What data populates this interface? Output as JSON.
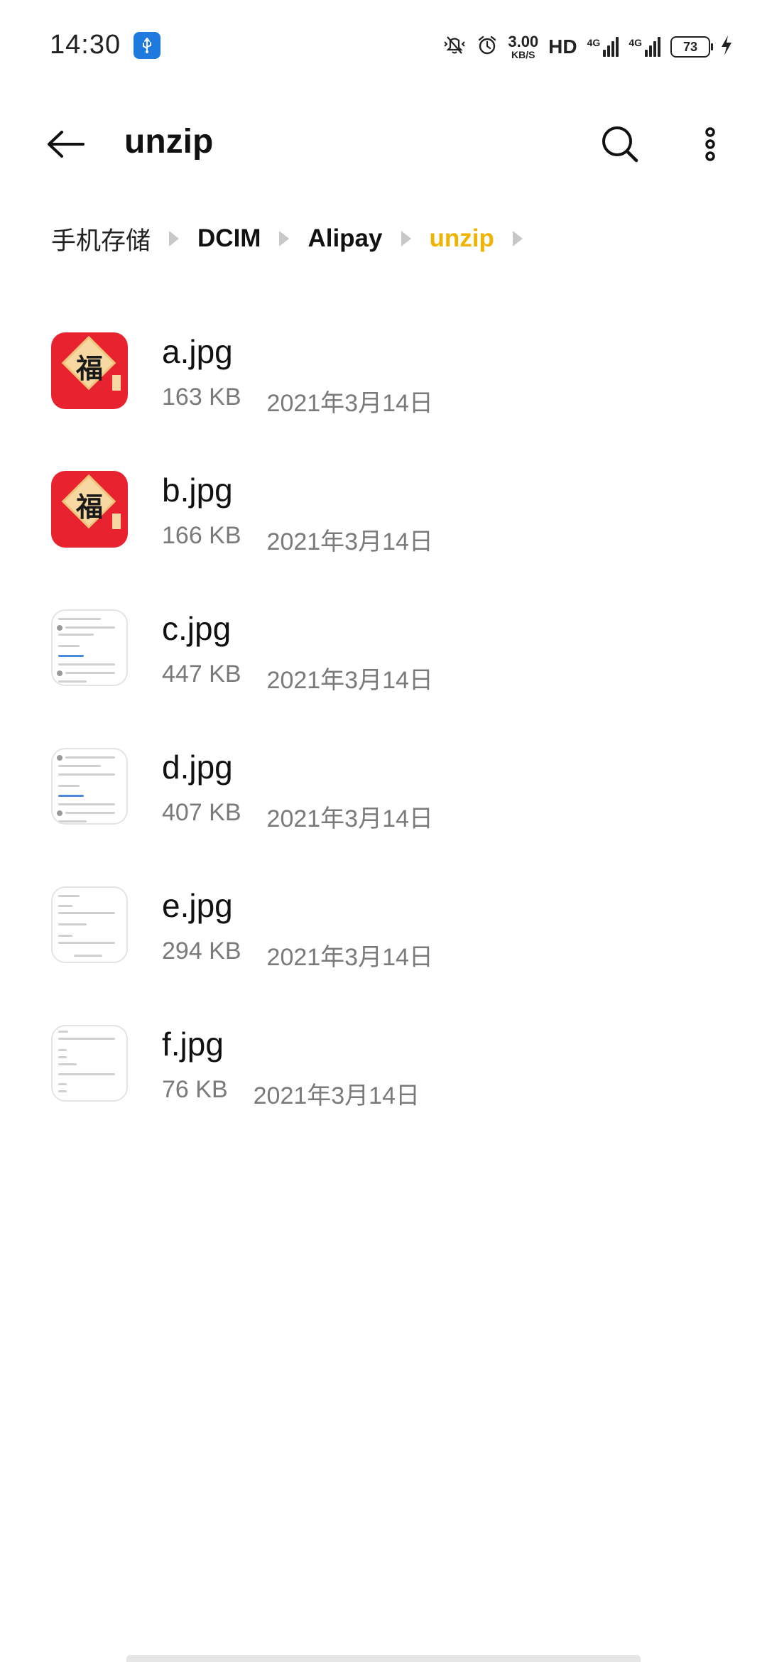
{
  "status_bar": {
    "time": "14:30",
    "net_speed_value": "3.00",
    "net_speed_unit": "KB/S",
    "hd_label": "HD",
    "signal1_label": "4G",
    "signal2_label": "4G",
    "battery_level": "73",
    "icons": [
      "usb-icon",
      "vibrate-mute-icon",
      "alarm-icon",
      "charging-icon"
    ]
  },
  "toolbar": {
    "title": "unzip"
  },
  "breadcrumb": {
    "items": [
      "手机存储",
      "DCIM",
      "Alipay",
      "unzip"
    ],
    "active_color": "#f0b400"
  },
  "files": [
    {
      "name": "a.jpg",
      "size": "163 KB",
      "date": "2021年3月14日",
      "thumb": "fu-red"
    },
    {
      "name": "b.jpg",
      "size": "166 KB",
      "date": "2021年3月14日",
      "thumb": "fu-red"
    },
    {
      "name": "c.jpg",
      "size": "447 KB",
      "date": "2021年3月14日",
      "thumb": "screenshot"
    },
    {
      "name": "d.jpg",
      "size": "407 KB",
      "date": "2021年3月14日",
      "thumb": "screenshot"
    },
    {
      "name": "e.jpg",
      "size": "294 KB",
      "date": "2021年3月14日",
      "thumb": "screenshot"
    },
    {
      "name": "f.jpg",
      "size": "76 KB",
      "date": "2021年3月14日",
      "thumb": "screenshot"
    }
  ],
  "thumb_fu_char": "福"
}
